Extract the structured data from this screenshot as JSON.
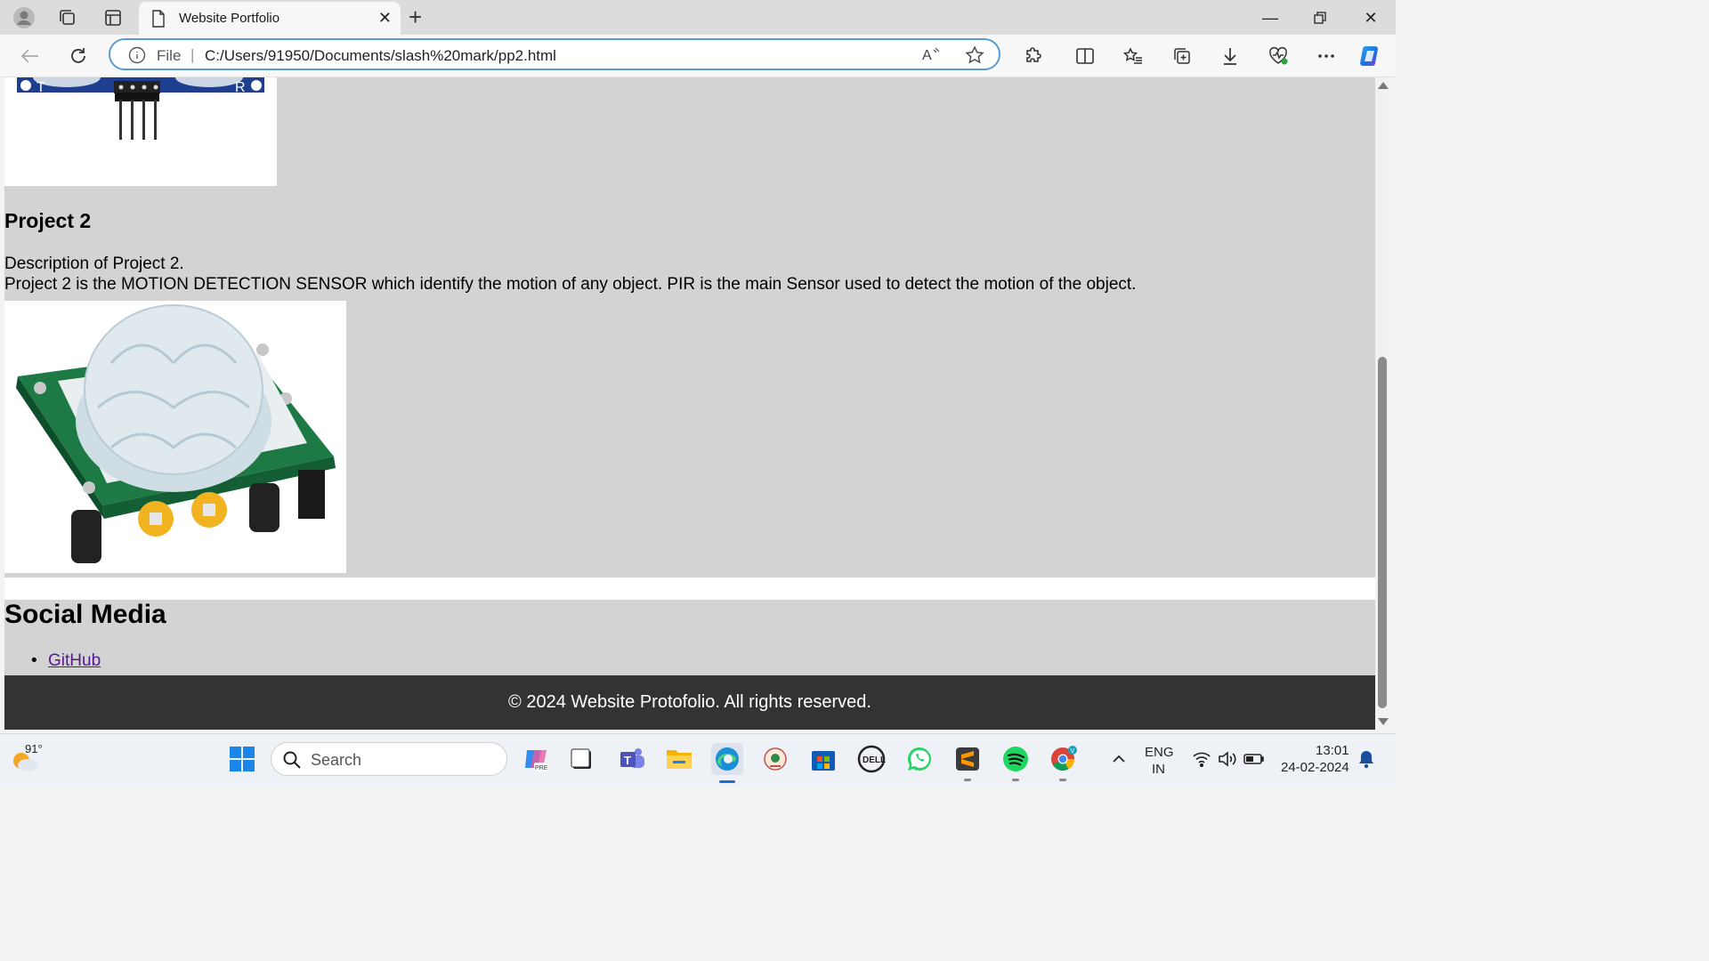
{
  "browser": {
    "tab_title": "Website Portfolio",
    "address_prefix": "File",
    "url": "C:/Users/91950/Documents/slash%20mark/pp2.html"
  },
  "page": {
    "project": {
      "title": "Project 2",
      "description": "Description of Project 2.",
      "detail": "Project 2 is the MOTION DETECTION SENSOR which identify the motion of any object. PIR is the main Sensor used to detect the motion of the object."
    },
    "social": {
      "title": "Social Media",
      "links": [
        {
          "label": "GitHub"
        }
      ]
    },
    "footer": "© 2024 Website Protofolio. All rights reserved."
  },
  "taskbar": {
    "weather_temp": "91°",
    "search_placeholder": "Search",
    "language_line1": "ENG",
    "language_line2": "IN",
    "time": "13:01",
    "date": "24-02-2024"
  },
  "colors": {
    "page_bg": "#d3d3d3",
    "footer_bg": "#333333",
    "link": "#551a8b",
    "omnibox_border": "#5b9bd5"
  }
}
